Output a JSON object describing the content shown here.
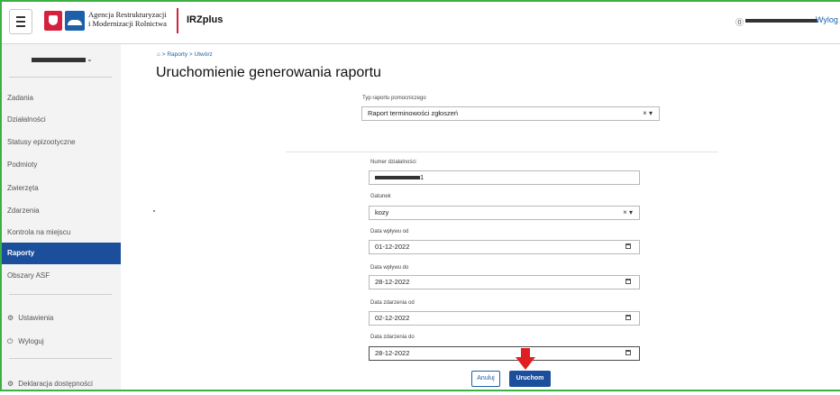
{
  "header": {
    "agency_line1": "Agencja Restrukturyzacji",
    "agency_line2": "i Modernizacji Rolnictwa",
    "app_name": "IRZplus",
    "user_icon": "⓪",
    "logout_label": "Wylog"
  },
  "sidebar": {
    "items": [
      {
        "label": "Zadania"
      },
      {
        "label": "Działalności"
      },
      {
        "label": "Statusy epizootyczne"
      },
      {
        "label": "Podmioty"
      },
      {
        "label": "Zwierzęta"
      },
      {
        "label": "Zdarzenia"
      },
      {
        "label": "Kontrola na miejscu"
      },
      {
        "label": "Raporty"
      },
      {
        "label": "Obszary ASF"
      }
    ],
    "settings_label": "Ustawienia",
    "logout_label": "Wyloguj",
    "accessibility_label": "Deklaracja dostępności"
  },
  "breadcrumb": {
    "home": "⌂",
    "path": "> Raporty > Utwórz"
  },
  "page_title": "Uruchomienie generowania raportu",
  "form": {
    "report_type_label": "Typ raportu pomocniczego",
    "report_type_value": "Raport terminowości zgłoszeń",
    "activity_number_label": "Numer działalności",
    "activity_number_suffix": "1",
    "species_label": "Gatunek",
    "species_value": "kozy",
    "received_from_label": "Data wpływu od",
    "received_from_value": "01-12-2022",
    "received_to_label": "Data wpływu do",
    "received_to_value": "28-12-2022",
    "event_from_label": "Data zdarzenia od",
    "event_from_value": "02-12-2022",
    "event_to_label": "Data zdarzenia do",
    "event_to_value": "28-12-2022",
    "clear_symbol": "×",
    "dropdown_symbol": "▾"
  },
  "buttons": {
    "cancel": "Anuluj",
    "run": "Uruchom"
  },
  "colors": {
    "primary": "#1b4f9c",
    "frame": "#3cb043",
    "annotation_arrow": "#e02020"
  }
}
